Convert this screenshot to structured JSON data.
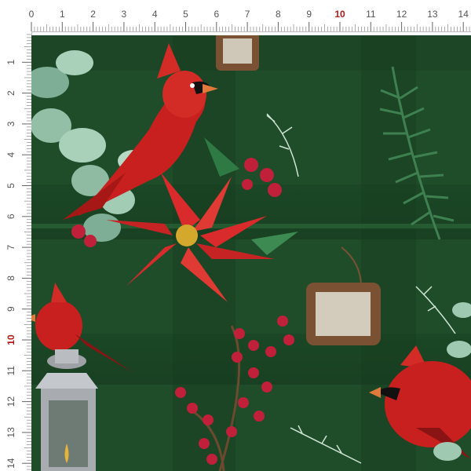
{
  "ruler": {
    "unit_marks": [
      "0",
      "1",
      "2",
      "3",
      "4",
      "5",
      "6",
      "7",
      "8",
      "9",
      "10",
      "11",
      "12",
      "13",
      "14"
    ],
    "highlight_mark": "10",
    "highlight_color": "#b31b1b"
  },
  "fabric": {
    "background_color": "#1f4d2a",
    "plaid_color": "#173d20",
    "motifs": [
      "cardinal-bird",
      "poinsettia-flower",
      "eucalyptus-leaves",
      "pine-branch",
      "red-berries",
      "wooden-frame-tag",
      "silver-lantern"
    ]
  },
  "colors": {
    "cardinal_red": "#c8201e",
    "poinsettia_red": "#d92b2b",
    "leaf_green": "#2f7a44",
    "eucalyptus": "#9fc9b0",
    "berry_red": "#c0203a",
    "lantern_silver": "#b9bcc0",
    "tag_wood": "#7a5233"
  }
}
